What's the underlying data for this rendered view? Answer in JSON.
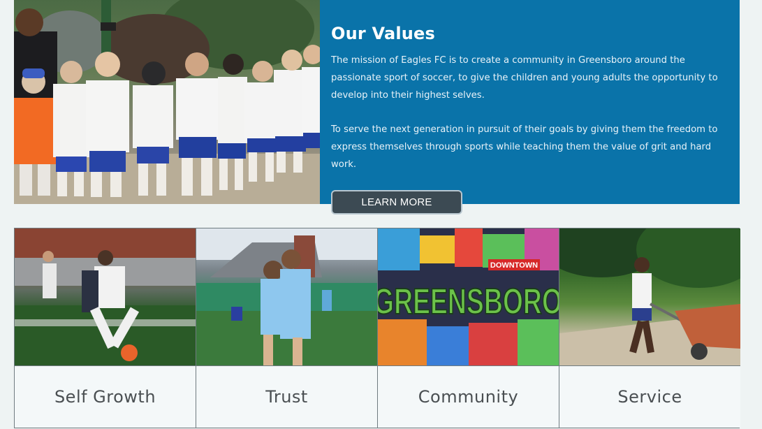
{
  "values": {
    "title": "Our Values",
    "paragraph_1": "The mission of Eagles FC is to create a community in Greensboro around the passionate sport of soccer, to give the children and young adults the opportunity to develop into their highest selves.",
    "paragraph_2": "To serve the next generation in pursuit of their goals by giving them the freedom to express themselves through sports while teaching them the value of grit and hard work.",
    "button_label": "LEARN MORE",
    "panel_color": "#0a73a9"
  },
  "mural": {
    "word": "GREENSBORO",
    "tag": "DOWNTOWN"
  },
  "cards": [
    {
      "label": "Self Growth",
      "image": "soccer-player-dribbling"
    },
    {
      "label": "Trust",
      "image": "teammates-hugging"
    },
    {
      "label": "Community",
      "image": "greensboro-mural"
    },
    {
      "label": "Service",
      "image": "boy-with-wheelbarrow"
    }
  ]
}
